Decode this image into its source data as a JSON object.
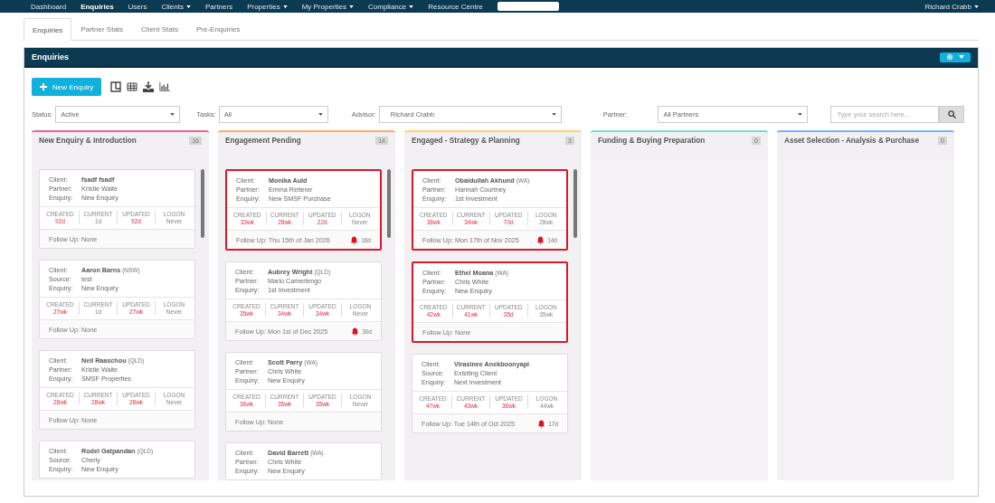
{
  "nav": {
    "items": [
      {
        "label": "Dashboard",
        "dropdown": false,
        "selected": false
      },
      {
        "label": "Enquiries",
        "dropdown": false,
        "selected": true
      },
      {
        "label": "Users",
        "dropdown": false,
        "selected": false
      },
      {
        "label": "Clients",
        "dropdown": true,
        "selected": false
      },
      {
        "label": "Partners",
        "dropdown": false,
        "selected": false
      },
      {
        "label": "Properties",
        "dropdown": true,
        "selected": false
      },
      {
        "label": "My Properties",
        "dropdown": true,
        "selected": false
      },
      {
        "label": "Compliance",
        "dropdown": true,
        "selected": false
      },
      {
        "label": "Resource Centre",
        "dropdown": false,
        "selected": false
      }
    ],
    "user": "Richard Crabb"
  },
  "tabs": [
    {
      "label": "Enquiries",
      "selected": true
    },
    {
      "label": "Partner Stats",
      "selected": false
    },
    {
      "label": "Client Stats",
      "selected": false
    },
    {
      "label": "Pre-Enquiries",
      "selected": false
    }
  ],
  "panel": {
    "title": "Enquiries"
  },
  "toolbar": {
    "new_button": "New Enquiry"
  },
  "filters": [
    {
      "label": "Status:",
      "value": "Active"
    },
    {
      "label": "Tasks:",
      "value": "All"
    },
    {
      "label": "Advisor:",
      "value": "Richard Crabb"
    },
    {
      "label": "Partner:",
      "value": "All Partners"
    }
  ],
  "search": {
    "placeholder": "Type your search here..."
  },
  "columns": [
    {
      "title": "New Enquiry & Introduction",
      "count": "16",
      "color": "#f06292",
      "scrollbar": true,
      "cards": [
        {
          "flagged": false,
          "fields": [
            {
              "label": "Client:",
              "value": "fsadf fsadf"
            },
            {
              "label": "Partner:",
              "value": "Kristie Waite"
            },
            {
              "label": "Enquiry:",
              "value": "New Enquiry"
            }
          ],
          "stats": [
            {
              "label": "CREATED",
              "value": "92d",
              "overdue": true
            },
            {
              "label": "CURRENT",
              "value": "1d",
              "overdue": false
            },
            {
              "label": "UPDATED",
              "value": "92d",
              "overdue": true
            },
            {
              "label": "LOGON",
              "value": "Never",
              "overdue": false
            }
          ],
          "follow_up": "Follow Up: None"
        },
        {
          "flagged": false,
          "fields": [
            {
              "label": "Client:",
              "value": "Aaron Barns",
              "region": "(NSW)"
            },
            {
              "label": "Source:",
              "value": "test"
            },
            {
              "label": "Enquiry:",
              "value": "New Enquiry"
            }
          ],
          "stats": [
            {
              "label": "CREATED",
              "value": "27wk",
              "overdue": true
            },
            {
              "label": "CURRENT",
              "value": "1d",
              "overdue": false
            },
            {
              "label": "UPDATED",
              "value": "27wk",
              "overdue": true
            },
            {
              "label": "LOGON",
              "value": "Never",
              "overdue": false
            }
          ],
          "follow_up": "Follow Up: None"
        },
        {
          "flagged": false,
          "fields": [
            {
              "label": "Client:",
              "value": "Neil Raaschou",
              "region": "(QLD)"
            },
            {
              "label": "Partner:",
              "value": "Kristie Waite"
            },
            {
              "label": "Enquiry:",
              "value": "SMSF Properties"
            }
          ],
          "stats": [
            {
              "label": "CREATED",
              "value": "28wk",
              "overdue": true
            },
            {
              "label": "CURRENT",
              "value": "28wk",
              "overdue": true
            },
            {
              "label": "UPDATED",
              "value": "28wk",
              "overdue": true
            },
            {
              "label": "LOGON",
              "value": "Never",
              "overdue": false
            }
          ],
          "follow_up": "Follow Up: None"
        },
        {
          "flagged": false,
          "fields": [
            {
              "label": "Client:",
              "value": "Rodel Gatpandan",
              "region": "(QLD)"
            },
            {
              "label": "Source:",
              "value": "Cherly"
            },
            {
              "label": "Enquiry:",
              "value": "New Enquiry"
            }
          ]
        }
      ]
    },
    {
      "title": "Engagement Pending",
      "count": "14",
      "color": "#ffab6e",
      "scrollbar": true,
      "cards": [
        {
          "flagged": true,
          "fields": [
            {
              "label": "Client:",
              "value": "Monika Auld"
            },
            {
              "label": "Partner:",
              "value": "Emma Reiterer"
            },
            {
              "label": "Enquiry:",
              "value": "New SMSF Purchase"
            }
          ],
          "stats": [
            {
              "label": "CREATED",
              "value": "33wk",
              "overdue": true
            },
            {
              "label": "CURRENT",
              "value": "28wk",
              "overdue": true
            },
            {
              "label": "UPDATED",
              "value": "22d",
              "overdue": true
            },
            {
              "label": "LOGON",
              "value": "Never",
              "overdue": false
            }
          ],
          "follow_up": "Follow Up: Thu 15th of Jan 2026",
          "reminder": "16d"
        },
        {
          "flagged": false,
          "fields": [
            {
              "label": "Client:",
              "value": "Aubrey Wright",
              "region": "(QLD)"
            },
            {
              "label": "Partner:",
              "value": "Mario Camerlengo"
            },
            {
              "label": "Enquiry:",
              "value": "1st Investment"
            }
          ],
          "stats": [
            {
              "label": "CREATED",
              "value": "35wk",
              "overdue": true
            },
            {
              "label": "CURRENT",
              "value": "34wk",
              "overdue": true
            },
            {
              "label": "UPDATED",
              "value": "34wk",
              "overdue": true
            },
            {
              "label": "LOGON",
              "value": "Never",
              "overdue": false
            }
          ],
          "follow_up": "Follow Up: Mon 1st of Dec 2025",
          "reminder": "30d"
        },
        {
          "flagged": false,
          "fields": [
            {
              "label": "Client:",
              "value": "Scott Parry",
              "region": "(WA)"
            },
            {
              "label": "Partner:",
              "value": "Chris White"
            },
            {
              "label": "Enquiry:",
              "value": "New Enquiry"
            }
          ],
          "stats": [
            {
              "label": "CREATED",
              "value": "36wk",
              "overdue": true
            },
            {
              "label": "CURRENT",
              "value": "35wk",
              "overdue": true
            },
            {
              "label": "UPDATED",
              "value": "35wk",
              "overdue": true
            },
            {
              "label": "LOGON",
              "value": "Never",
              "overdue": false
            }
          ],
          "follow_up": "Follow Up: None"
        },
        {
          "flagged": false,
          "fields": [
            {
              "label": "Client:",
              "value": "David Barrett",
              "region": "(WA)"
            },
            {
              "label": "Partner:",
              "value": "Chris White"
            },
            {
              "label": "Enquiry:",
              "value": "New Enquiry"
            }
          ]
        }
      ]
    },
    {
      "title": "Engaged - Strategy & Planning",
      "count": "3",
      "color": "#ffd36e",
      "scrollbar": true,
      "cards": [
        {
          "flagged": true,
          "fields": [
            {
              "label": "Client:",
              "value": "Obaidullah Akhund",
              "region": "(WA)"
            },
            {
              "label": "Partner:",
              "value": "Hannah Courtney"
            },
            {
              "label": "Enquiry:",
              "value": "1st Investment"
            }
          ],
          "stats": [
            {
              "label": "CREATED",
              "value": "38wk",
              "overdue": true
            },
            {
              "label": "CURRENT",
              "value": "34wk",
              "overdue": true
            },
            {
              "label": "UPDATED",
              "value": "70d",
              "overdue": true
            },
            {
              "label": "LOGON",
              "value": "28wk",
              "overdue": false
            }
          ],
          "follow_up": "Follow Up: Mon 17th of Nov 2025",
          "reminder": "14d"
        },
        {
          "flagged": true,
          "fields": [
            {
              "label": "Client:",
              "value": "Ethel Moana",
              "region": "(WA)"
            },
            {
              "label": "Partner:",
              "value": "Chris White"
            },
            {
              "label": "Enquiry:",
              "value": "New Enquiry"
            }
          ],
          "stats": [
            {
              "label": "CREATED",
              "value": "42wk",
              "overdue": true
            },
            {
              "label": "CURRENT",
              "value": "41wk",
              "overdue": true
            },
            {
              "label": "UPDATED",
              "value": "35d",
              "overdue": true
            },
            {
              "label": "LOGON",
              "value": "35wk",
              "overdue": false
            }
          ],
          "follow_up": "Follow Up: None"
        },
        {
          "flagged": false,
          "fields": [
            {
              "label": "Client:",
              "value": "Virasinee Anekboonyapi"
            },
            {
              "label": "Source:",
              "value": "Exisiting Client"
            },
            {
              "label": "Enquiry:",
              "value": "Next Investment"
            }
          ],
          "stats": [
            {
              "label": "CREATED",
              "value": "47wk",
              "overdue": true
            },
            {
              "label": "CURRENT",
              "value": "43wk",
              "overdue": true
            },
            {
              "label": "UPDATED",
              "value": "36wk",
              "overdue": true
            },
            {
              "label": "LOGON",
              "value": "44wk",
              "overdue": false
            }
          ],
          "follow_up": "Follow Up: Tue 14th of Oct 2025",
          "reminder": "17d"
        }
      ]
    },
    {
      "title": "Funding & Buying Preparation",
      "count": "0",
      "color": "#7fd6d0",
      "scrollbar": false
    },
    {
      "title": "Asset Selection - Analysis & Purchase",
      "count": "0",
      "color": "#7fb2f0",
      "scrollbar": false
    }
  ]
}
